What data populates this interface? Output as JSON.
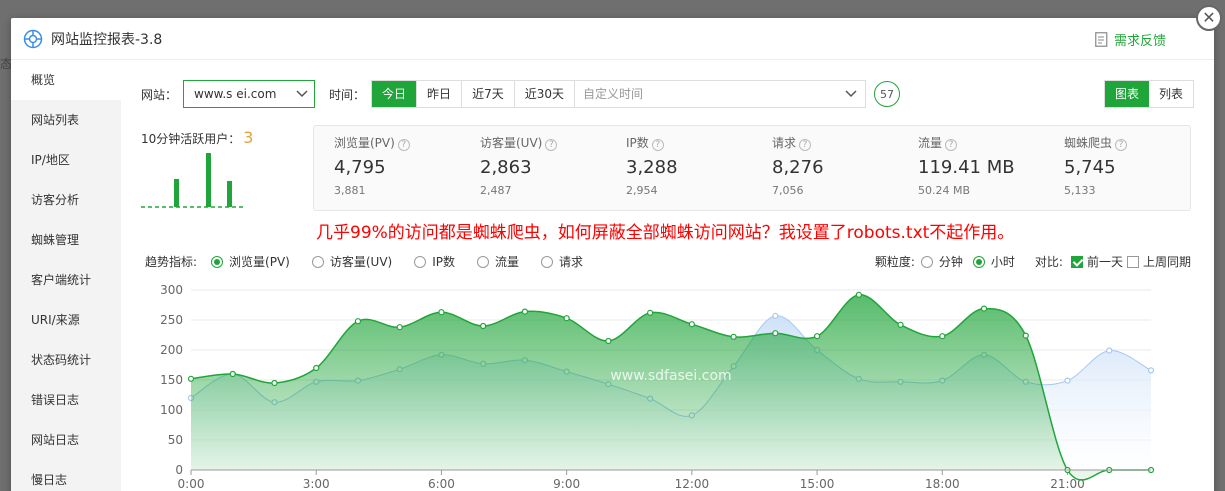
{
  "dialog": {
    "title": "网站监控报表-3.8",
    "feedback": "需求反馈",
    "close_glyph": "✕"
  },
  "background": {
    "tab_text": "态"
  },
  "sidebar": {
    "items": [
      {
        "label": "概览",
        "active": true
      },
      {
        "label": "网站列表"
      },
      {
        "label": "IP/地区"
      },
      {
        "label": "访客分析"
      },
      {
        "label": "蜘蛛管理"
      },
      {
        "label": "客户端统计"
      },
      {
        "label": "URI/来源"
      },
      {
        "label": "状态码统计"
      },
      {
        "label": "错误日志"
      },
      {
        "label": "网站日志"
      },
      {
        "label": "慢日志"
      }
    ]
  },
  "toolbar": {
    "site_label": "网站：",
    "site_value": "www.s   ei.com",
    "time_label": "时间：",
    "ranges": [
      "今日",
      "昨日",
      "近7天",
      "近30天"
    ],
    "active_range": 0,
    "custom_placeholder": "自定义时间",
    "refresh_count": "57",
    "views": [
      "图表",
      "列表"
    ],
    "active_view": 0
  },
  "active_users": {
    "label": "10分钟活跃用户：",
    "count": "3"
  },
  "stats": [
    {
      "name": "浏览量(PV)",
      "value": "4,795",
      "prev": "3,881"
    },
    {
      "name": "访客量(UV)",
      "value": "2,863",
      "prev": "2,487"
    },
    {
      "name": "IP数",
      "value": "3,288",
      "prev": "2,954"
    },
    {
      "name": "请求",
      "value": "8,276",
      "prev": "7,056"
    },
    {
      "name": "流量",
      "value": "119.41 MB",
      "prev": "50.24 MB"
    },
    {
      "name": "蜘蛛爬虫",
      "value": "5,745",
      "prev": "5,133"
    }
  ],
  "notice": "几乎99%的访问都是蜘蛛爬虫，如何屏蔽全部蜘蛛访问网站？我设置了robots.txt不起作用。",
  "trend": {
    "label": "趋势指标:",
    "metrics": [
      "浏览量(PV)",
      "访客量(UV)",
      "IP数",
      "流量",
      "请求"
    ],
    "active_metric": 0,
    "granularity_label": "颗粒度:",
    "granularity": [
      "分钟",
      "小时"
    ],
    "active_granularity": 1,
    "compare_label": "对比:",
    "compare": [
      {
        "label": "前一天",
        "checked": true
      },
      {
        "label": "上周同期",
        "checked": false
      }
    ]
  },
  "colors": {
    "accent": "#20a53a",
    "notice": "#ff0000",
    "prev_series": "#a8c8f0"
  },
  "chart_data": {
    "type": "area",
    "watermark": "www.sdfasei.com",
    "x": [
      0,
      1,
      2,
      3,
      4,
      5,
      6,
      7,
      8,
      9,
      10,
      11,
      12,
      13,
      14,
      15,
      16,
      17,
      18,
      19,
      20,
      21,
      22,
      23
    ],
    "xticks": [
      "0:00",
      "3:00",
      "6:00",
      "9:00",
      "12:00",
      "15:00",
      "18:00",
      "21:00"
    ],
    "xtick_hours": [
      0,
      3,
      6,
      9,
      12,
      15,
      18,
      21
    ],
    "ylim": [
      0,
      300
    ],
    "yticks": [
      0,
      50,
      100,
      150,
      200,
      250,
      300
    ],
    "grid": true,
    "series": [
      {
        "values": [
          152,
          160,
          145,
          170,
          248,
          238,
          263,
          240,
          264,
          253,
          215,
          262,
          243,
          222,
          228,
          223,
          292,
          242,
          223,
          269,
          224,
          0,
          0,
          0
        ],
        "color": "#20a53a"
      },
      {
        "values": [
          120,
          160,
          113,
          147,
          149,
          168,
          192,
          177,
          183,
          164,
          143,
          119,
          91,
          173,
          257,
          200,
          152,
          147,
          149,
          192,
          147,
          149,
          199,
          166
        ],
        "color": "#a8c8f0"
      }
    ]
  }
}
